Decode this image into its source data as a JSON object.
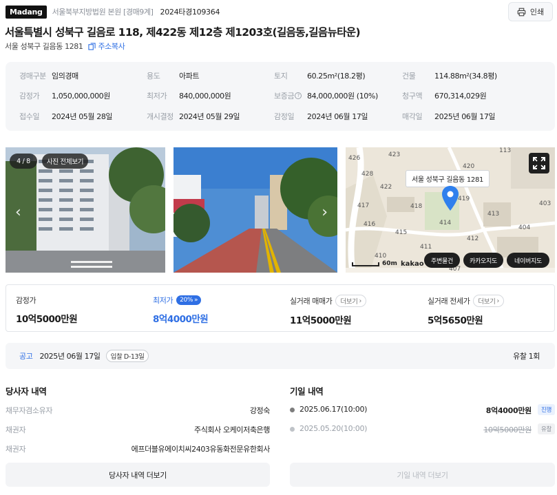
{
  "header": {
    "brand": "Madang",
    "court": "서울북부지방법원 본원 [경매9계]",
    "case_no": "2024타경109364",
    "print_label": "인쇄"
  },
  "title": "서울특별시 성북구 길음로 118, 제422동 제12층 제1203호(길음동,길음뉴타운)",
  "subaddress": "서울 성북구 길음동 1281",
  "copy_label": "주소복사",
  "info": {
    "type_k": "경매구분",
    "type_v": "임의경매",
    "use_k": "용도",
    "use_v": "아파트",
    "land_k": "토지",
    "land_v": "60.25m²(18.2평)",
    "bldg_k": "건물",
    "bldg_v": "114.88m²(34.8평)",
    "appr_k": "감정가",
    "appr_v": "1,050,000,000원",
    "min_k": "최저가",
    "min_v": "840,000,000원",
    "dep_k": "보증금",
    "dep_v": "84,000,000원 (10%)",
    "claim_k": "청구액",
    "claim_v": "670,314,029원",
    "recv_k": "접수일",
    "recv_v": "2024년 05월 28일",
    "start_k": "개시결정",
    "start_v": "2024년 05월 29일",
    "apprd_k": "감정일",
    "apprd_v": "2024년 06월 17일",
    "sale_k": "매각일",
    "sale_v": "2025년 06월 17일"
  },
  "gallery": {
    "counter": "4 / 8",
    "view_all": "사진 전체보기"
  },
  "map": {
    "label": "서울 성북구 길음동 1281",
    "scale": "60m",
    "provider": "kakao",
    "btn_nearby": "주변물건",
    "btn_kakao": "카카오지도",
    "btn_naver": "네이버지도",
    "numbers": [
      "426",
      "423",
      "113",
      "420",
      "428",
      "422",
      "417",
      "418",
      "419",
      "403",
      "416",
      "414",
      "413",
      "415",
      "411",
      "412",
      "404",
      "410",
      "407"
    ]
  },
  "prices": {
    "appraisal_label": "감정가",
    "appraisal_value": "10억5000만원",
    "min_label": "최저가",
    "min_pct": "20%",
    "min_value": "8억4000만원",
    "trade_label": "실거래 매매가",
    "trade_more": "더보기",
    "trade_value": "11억5000만원",
    "rent_label": "실거래 전세가",
    "rent_more": "더보기",
    "rent_value": "5억5650만원"
  },
  "notice": {
    "label": "공고",
    "date": "2025년 06월 17일",
    "dday": "입찰 D-13일",
    "fail": "유찰 1회"
  },
  "parties": {
    "title": "당사자 내역",
    "rows": [
      {
        "k": "채무자겸소유자",
        "v": "강정숙"
      },
      {
        "k": "채권자",
        "v": "주식회사 오케이저축은행"
      },
      {
        "k": "채권자",
        "v": "에프더블유에이치씨2403유동화전문유한회사"
      }
    ],
    "more": "당사자 내역 더보기"
  },
  "dates": {
    "title": "기일 내역",
    "rows": [
      {
        "date": "2025.06.17(10:00)",
        "amount": "8억4000만원",
        "status": "진행"
      },
      {
        "date": "2025.05.20(10:00)",
        "amount": "10억5000만원",
        "status": "유찰"
      }
    ],
    "more": "기일 내역 더보기"
  },
  "colors": {
    "accent": "#2f6fe4",
    "brand_bg": "#111111",
    "panel": "#f5f6f8"
  }
}
